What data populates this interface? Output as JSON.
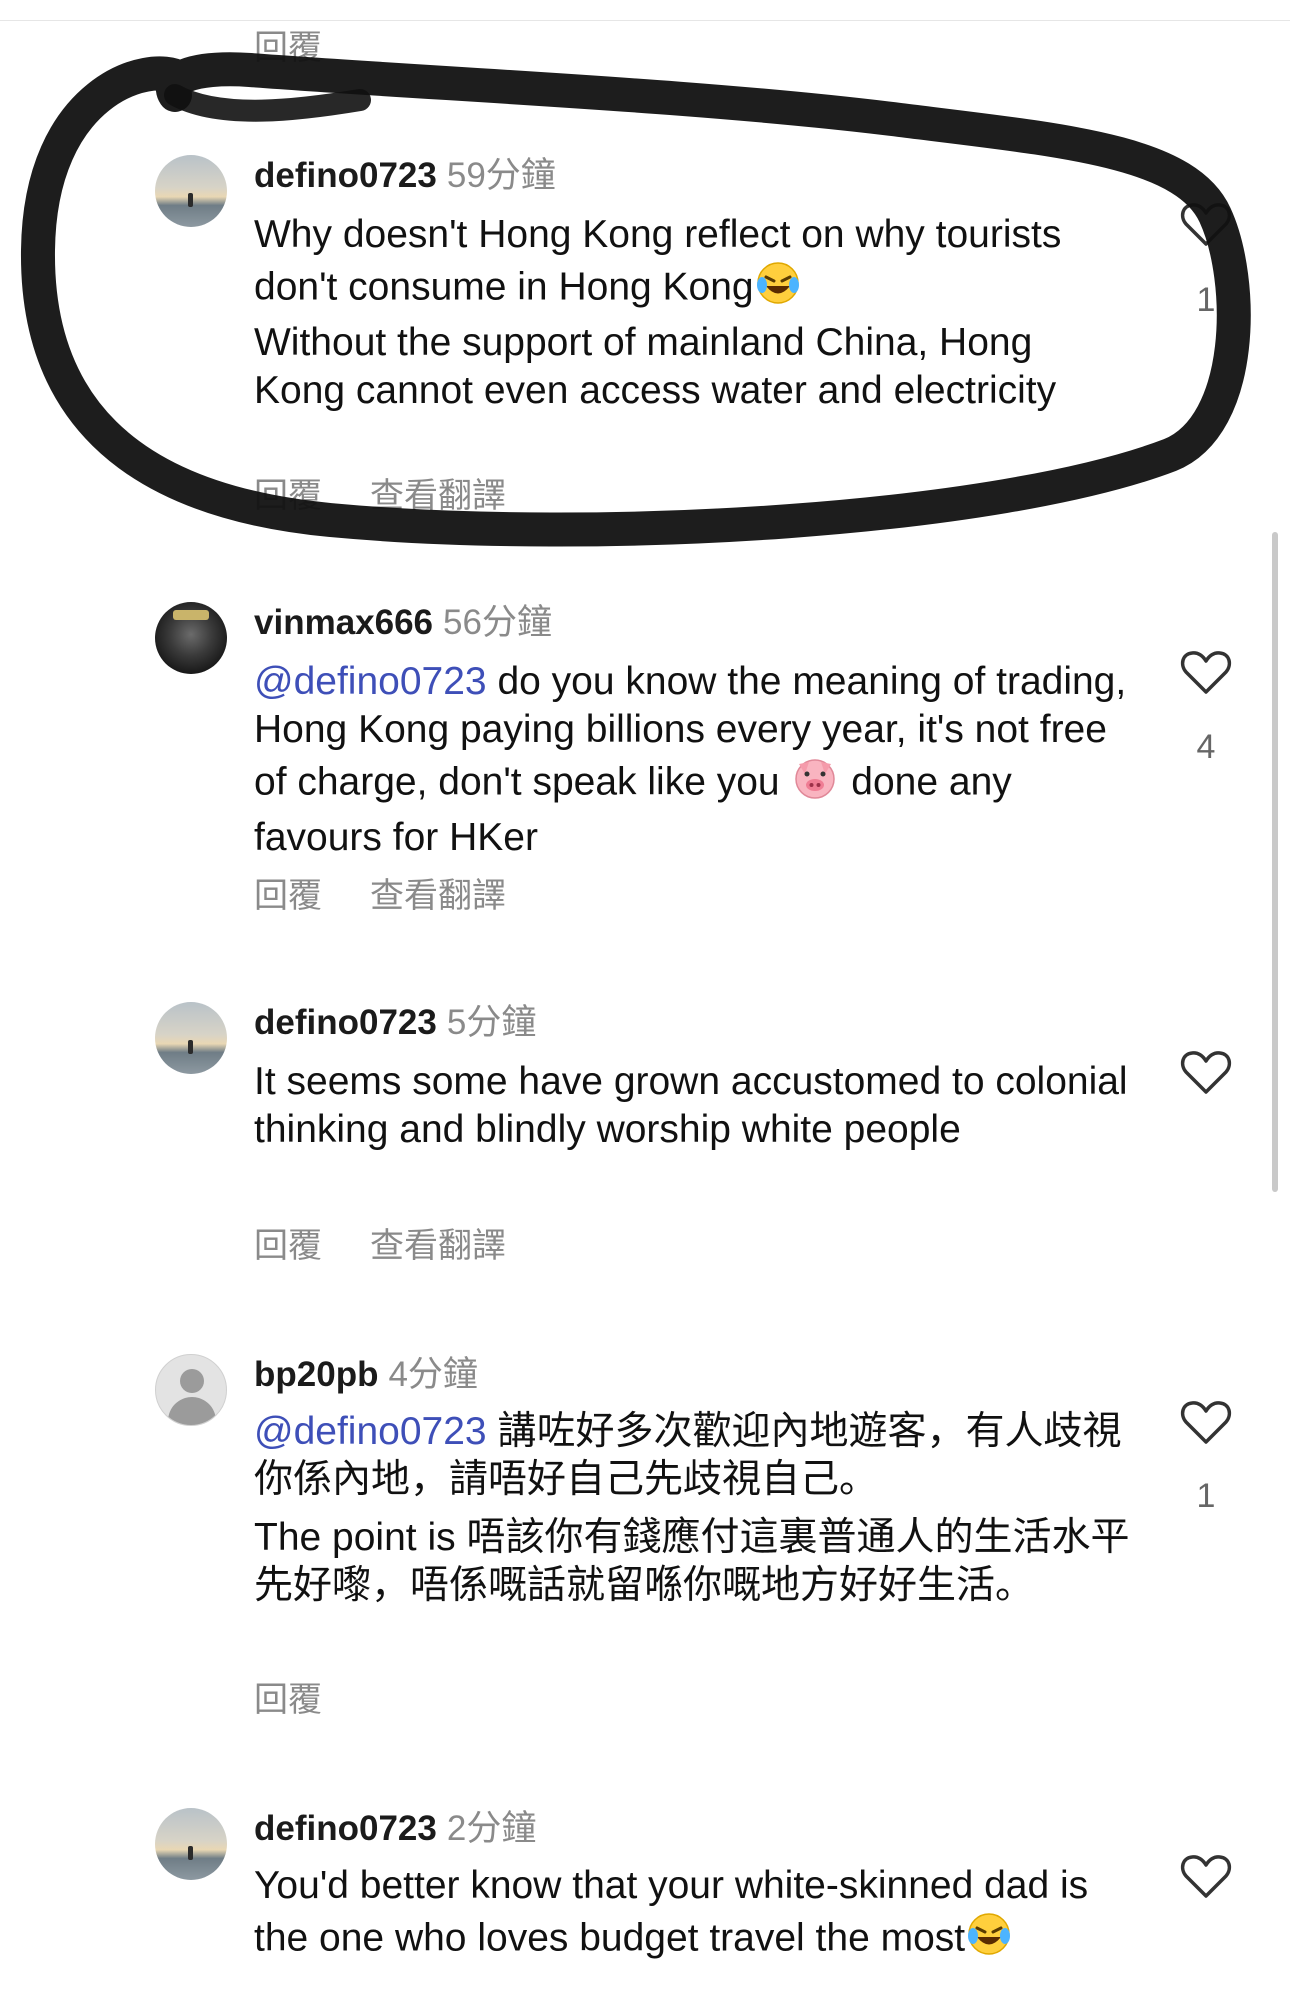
{
  "top": {
    "reply_label": "回覆"
  },
  "comments": [
    {
      "username": "defino0723",
      "time": "59分鐘",
      "mention": "",
      "text": "Why doesn't Hong Kong reflect on why tourists don't consume in Hong Kong",
      "text2": "Without the support of mainland China, Hong Kong cannot even access water and electricity",
      "reply": "回覆",
      "translate": "查看翻譯",
      "likes": "1"
    },
    {
      "username": "vinmax666",
      "time": "56分鐘",
      "mention": "@defino0723",
      "text": " do you know the meaning of trading, Hong Kong paying billions every year, it's not free of charge, don't speak like you ",
      "text_after_emoji": " done any favours for HKer",
      "reply": "回覆",
      "translate": "查看翻譯",
      "likes": "4"
    },
    {
      "username": "defino0723",
      "time": "5分鐘",
      "text": "It seems some have grown accustomed to colonial thinking and blindly worship white people",
      "reply": "回覆",
      "translate": "查看翻譯"
    },
    {
      "username": "bp20pb",
      "time": "4分鐘",
      "mention": "@defino0723",
      "text": " 講咗好多次歡迎內地遊客，有人歧視你係內地，請唔好自己先歧視自己。",
      "text2": "The point is 唔該你有錢應付這裏普通人的生活水平先好嚟，唔係嘅話就留喺你嘅地方好好生活。",
      "reply": "回覆",
      "likes": "1"
    },
    {
      "username": "defino0723",
      "time": "2分鐘",
      "text": "You'd better know that your white-skinned dad is the one who loves budget travel the most"
    }
  ],
  "colors": {
    "mention": "#3e4fb8",
    "muted": "#8a8a8a",
    "scribble": "#111111"
  }
}
